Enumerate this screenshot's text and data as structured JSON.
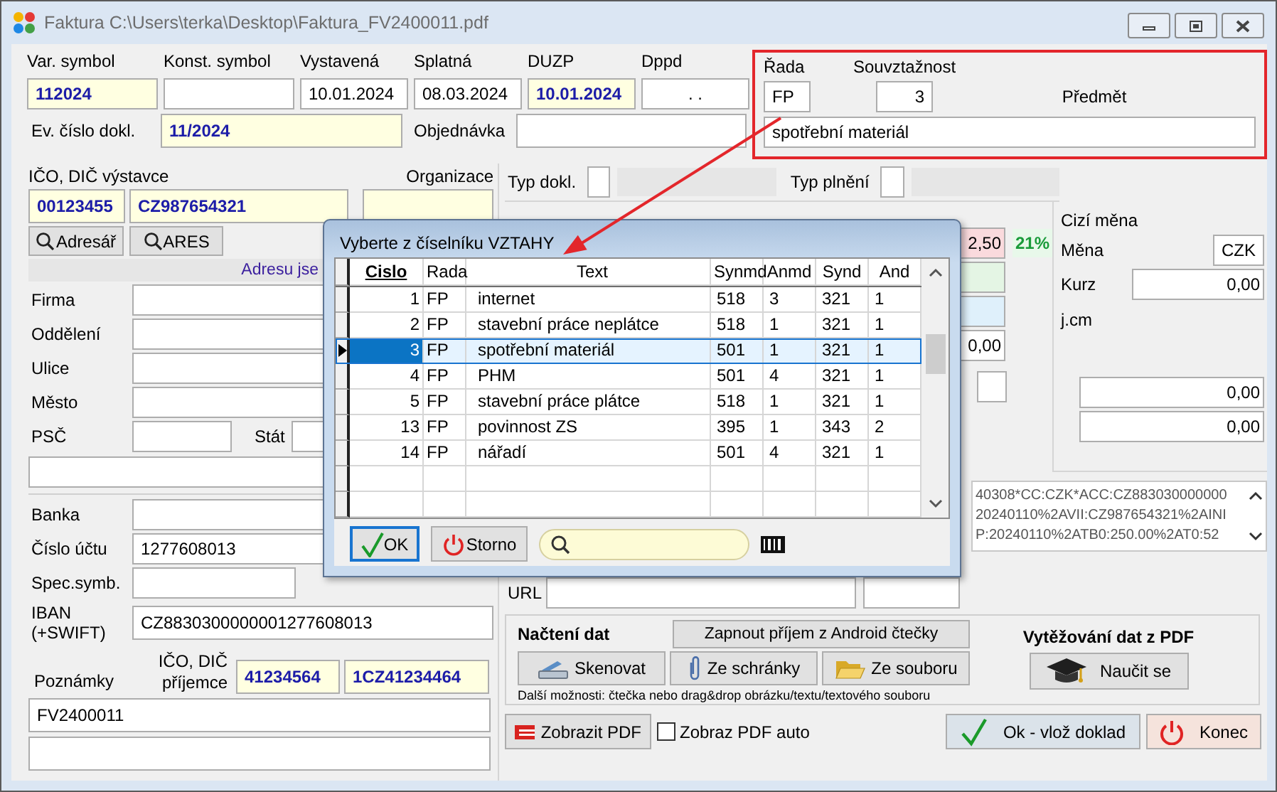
{
  "window": {
    "title": "Faktura C:\\Users\\terka\\Desktop\\Faktura_FV2400011.pdf"
  },
  "header": {
    "row1": [
      {
        "label": "Var. symbol",
        "value": "112024",
        "highlighted": true
      },
      {
        "label": "Konst. symbol",
        "highlighted": false
      },
      {
        "label": "Vystavená",
        "value": "10.01.2024",
        "highlighted": false
      },
      {
        "label": "Splatná",
        "value": "08.03.2024",
        "highlighted": false
      },
      {
        "label": "DUZP",
        "value": "10.01.2024",
        "highlighted": true
      },
      {
        "label": "Dppd",
        "value": ". .",
        "highlighted": false
      }
    ],
    "row2": [
      {
        "label": "Ev. číslo dokl.",
        "value": "11/2024",
        "highlighted": true
      },
      {
        "label": "Objednávka",
        "highlighted": false
      }
    ]
  },
  "series": {
    "rada_label": "Řada",
    "rada": "FP",
    "souvztaznost_label": "Souvztažnost",
    "souvztaznost": "3",
    "predmet_label": "Předmět",
    "predmet": "spotřební materiál"
  },
  "issuer": {
    "label": "IČO, DIČ výstavce",
    "ico": "00123455",
    "dic": "CZ987654321",
    "organizace_label": "Organizace",
    "buttons": [
      "Adresář",
      "ARES"
    ],
    "banner": "Adresu jse"
  },
  "address": [
    {
      "label": "Firma"
    },
    {
      "label": "Oddělení"
    },
    {
      "label": "Ulice"
    },
    {
      "label": "Město"
    }
  ],
  "psc_label": "PSČ",
  "stat_label": "Stát",
  "bank": [
    {
      "label": "Banka",
      "kind": "wide"
    },
    {
      "label": "Číslo účtu",
      "value": "1277608013",
      "kind": "wide"
    },
    {
      "label": "Spec.symb.",
      "kind": "short"
    },
    {
      "label": "IBAN (+SWIFT)",
      "value": "CZ8830300000001277608013",
      "kind": "wide"
    }
  ],
  "recipient": {
    "label": "IČO, DIČ příjemce",
    "ico": "41234564",
    "dic": "1CZ41234464"
  },
  "notes": {
    "label": "Poznámky",
    "value": "FV2400011"
  },
  "doc_type": {
    "typ_dokl_label": "Typ dokl.",
    "typ_plneni_label": "Typ plnění"
  },
  "amounts": {
    "base": "2,50",
    "vat_rate": "21%",
    "total": "0,00"
  },
  "foreign": {
    "title": "Cizí měna",
    "mena_label": "Měna",
    "mena": "CZK",
    "kurz_label": "Kurz",
    "kurz": "0,00",
    "jcm_label": "j.cm",
    "amounts": [
      "0,00",
      "0,00"
    ]
  },
  "qr_text": [
    "40308*CC:CZK*ACC:CZ883030000000",
    "20240110%2AVII:CZ987654321%2AINI",
    "P:20240110%2ATB0:250.00%2AT0:52"
  ],
  "url_label": "URL",
  "import": {
    "title": "Načtení dat",
    "android_button": "Zapnout příjem z Android čtečky",
    "buttons": [
      {
        "label": "Skenovat",
        "kind": "scanner"
      },
      {
        "label": "Ze schránky",
        "kind": "clip"
      },
      {
        "label": "Ze souboru",
        "kind": "folder"
      }
    ],
    "hint": "Další možnosti: čtečka nebo drag&drop obrázku/textu/textového souboru",
    "pdf_title": "Vytěžování dat z PDF",
    "learn_button": "Naučit se"
  },
  "footer": {
    "pdf_button": "Zobrazit PDF",
    "auto_pdf": {
      "label": "Zobraz PDF auto",
      "checked": false
    },
    "ok_button": "Ok - vlož doklad",
    "close_button": "Konec"
  },
  "dialog": {
    "title": "Vyberte z číselníku VZTAHY",
    "columns": [
      {
        "label": "Cislo",
        "sorted": true
      },
      {
        "label": "Rada",
        "sorted": false
      },
      {
        "label": "Text",
        "sorted": false
      },
      {
        "label": "Synmd",
        "sorted": false
      },
      {
        "label": "Anmd",
        "sorted": false
      },
      {
        "label": "Synd",
        "sorted": false
      },
      {
        "label": "And",
        "sorted": false
      }
    ],
    "rows": [
      {
        "cells": [
          "1",
          "FP",
          "internet",
          "518",
          "3",
          "321",
          "1"
        ],
        "selected": false
      },
      {
        "cells": [
          "2",
          "FP",
          "stavební práce neplátce",
          "518",
          "1",
          "321",
          "1"
        ],
        "selected": false
      },
      {
        "cells": [
          "3",
          "FP",
          "spotřební materiál",
          "501",
          "1",
          "321",
          "1"
        ],
        "selected": true
      },
      {
        "cells": [
          "4",
          "FP",
          "PHM",
          "501",
          "4",
          "321",
          "1"
        ],
        "selected": false
      },
      {
        "cells": [
          "5",
          "FP",
          "stavební práce plátce",
          "518",
          "1",
          "321",
          "1"
        ],
        "selected": false
      },
      {
        "cells": [
          "13",
          "FP",
          "povinnost ZS",
          "395",
          "1",
          "343",
          "2"
        ],
        "selected": false
      },
      {
        "cells": [
          "14",
          "FP",
          "nářadí",
          "501",
          "4",
          "321",
          "1"
        ],
        "selected": false
      }
    ],
    "ok_button": "OK",
    "cancel_button": "Storno"
  }
}
